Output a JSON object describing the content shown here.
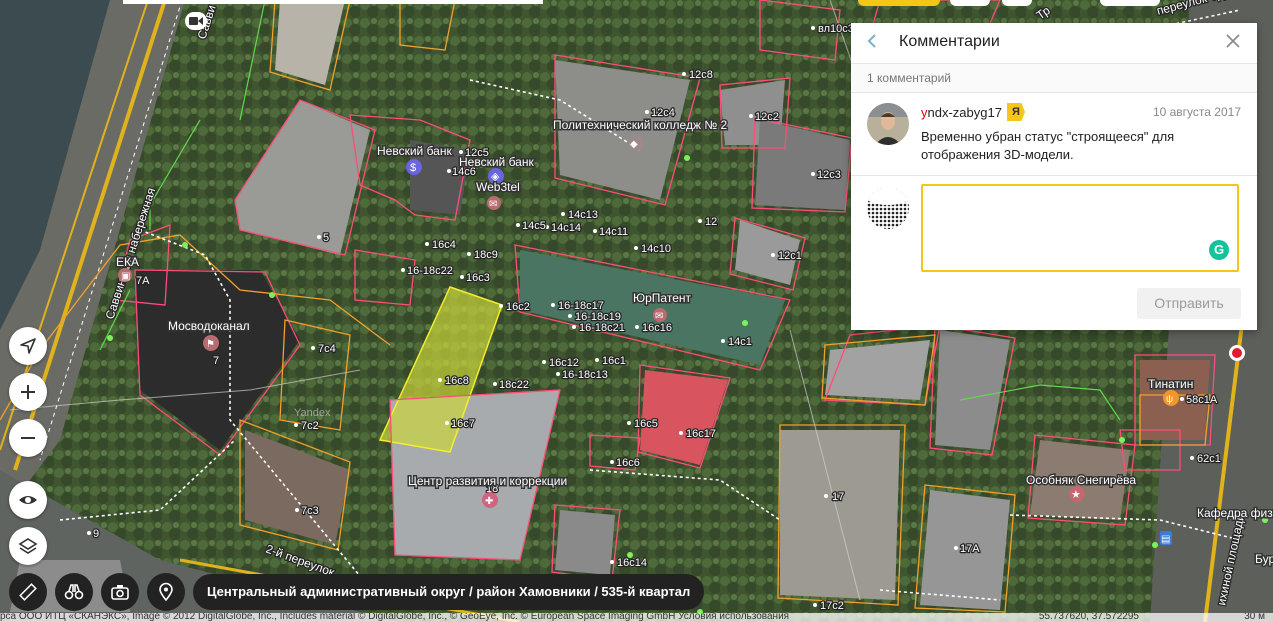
{
  "map": {
    "labels": {
      "vl10c3": "вл10с3",
      "12c8": "12с8",
      "12c4": "12с4",
      "12c2": "12с2",
      "12c5": "12с5",
      "14c6": "14с6",
      "12c3": "12с3",
      "14c13": "14с13",
      "14c5": "14с5",
      "14c14": "14с14",
      "14c11": "14с11",
      "12": "12",
      "16c4": "16с4",
      "18c9": "18с9",
      "14c10": "14с10",
      "12c1": "12с1",
      "16-18c22": "16-18с22",
      "16c3": "16с3",
      "5": "5",
      "7A": "7А",
      "16c2": "16с2",
      "16-18c17": "16-18с17",
      "16-18c19": "16-18с19",
      "16-18c21": "16-18с21",
      "16c16": "16с16",
      "14c1": "14с1",
      "7": "7",
      "7c4": "7с4",
      "16c12": "16с12",
      "16c1": "16с1",
      "16-18c13": "16-18с13",
      "16c8": "16с8",
      "18c22": "18с22",
      "16c7": "16с7",
      "16c5": "16с5",
      "16c17": "16с17",
      "16c6": "16с6",
      "7c2": "7с2",
      "yandex": "Yandex",
      "18": "18",
      "7c3": "7с3",
      "9": "9",
      "16c14": "16с14",
      "17": "17",
      "17A": "17А",
      "17c2": "17с2",
      "58c1A": "58с1А",
      "62c1": "62с1"
    },
    "pois": {
      "nevsky1": "Невский банк",
      "nevsky2": "Невский банк",
      "websitel": "Web3tel",
      "polytech": "Политехнический колледж № 2",
      "yurpatent": "ЮрПатент",
      "mosvodokanal": "Мосводоканал",
      "eka": "ЕКА",
      "center": "Центр развития и коррекции",
      "tinatin": "Тинатин",
      "osobnyak": "Особняк Снегирёва",
      "kafedra": "Кафедра физи",
      "bur": "Бур"
    },
    "streets": {
      "savvinskaya": "Саввинская набережная",
      "savv_top": "Савви",
      "pereulok": "2-й переулок",
      "pereulok_tr": "переулок Тру",
      "ploschad": "ихиной площади",
      "dr": "Тр"
    }
  },
  "address_bar": "Центральный административный округ / район Хамовники / 535-й квартал",
  "copyright": "рса ООО ИТЦ «СКАНЭКС», Image © 2012 DigitalGlobe, Inc., Includes material © DigitalGlobe, Inc., © GeoEye, Inc. © European Space Imaging GmbH Условия использования",
  "coords": "55.737620, 37.572295",
  "scale": "30 м",
  "panel": {
    "title": "Комментарии",
    "count": "1 комментарий",
    "comment": {
      "user_first": "y",
      "user_rest": "ndx-zabyg17",
      "badge": "Я",
      "date": "10 августа 2017",
      "text": "Временно убран статус \"строящееся\" для отображения 3D-модели."
    },
    "reply_placeholder": "",
    "send_label": "Отправить"
  },
  "colors": {
    "accent": "#f5c518",
    "parcel_border": "#ff4d7a",
    "building_outline": "#f2a12b",
    "highlight_fill": "#d8e23a"
  },
  "icons": [
    "navigate-icon",
    "zoom-in-icon",
    "zoom-out-icon",
    "eye-icon",
    "layers-icon",
    "ruler-icon",
    "binoculars-icon",
    "camera-icon",
    "pin-icon",
    "back-arrow-icon",
    "close-icon"
  ]
}
